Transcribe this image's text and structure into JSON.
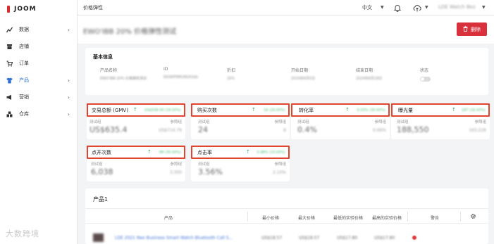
{
  "app": {
    "logo": "JOOM"
  },
  "sidebar": {
    "items": [
      {
        "label": "数据",
        "icon": "analytics-icon"
      },
      {
        "label": "店铺",
        "icon": "store-icon"
      },
      {
        "label": "订单",
        "icon": "cart-icon"
      },
      {
        "label": "产品",
        "icon": "tshirt-icon"
      },
      {
        "label": "营销",
        "icon": "megaphone-icon"
      },
      {
        "label": "仓库",
        "icon": "warehouse-icon"
      }
    ],
    "watermark": "大数跨境"
  },
  "topbar": {
    "title": "价格弹性",
    "language": "中文",
    "user": "LDE Watch Bez"
  },
  "header": {
    "title": "EWO'IBB 20% 价格弹性测试",
    "delete_label": "删除"
  },
  "basic_info": {
    "title": "基本信息",
    "fields": {
      "product_name": {
        "label": "产品名称",
        "value": "EWO'IBB 20% 价格弹性测试"
      },
      "id": {
        "label": "ID",
        "value": "6IGWIPNRUNUlUlab"
      },
      "discount": {
        "label": "折扣",
        "value": "20%"
      },
      "start_date": {
        "label": "开始日期",
        "value": "2024年6月5日"
      },
      "end_date": {
        "label": "结束日期",
        "value": "2024年6月18日"
      },
      "status": {
        "label": "状态"
      }
    }
  },
  "metrics": [
    {
      "name": "交易总额 (GMV)",
      "change": "US$508.00 (19.00%)",
      "test_label": "测试组",
      "ref_label": "参照组",
      "test_value": "US$635.4",
      "ref_value": "US$714.79"
    },
    {
      "name": "购买次数",
      "change": "16 (20.00%)",
      "test_label": "测试组",
      "ref_label": "参照组",
      "test_value": "24",
      "ref_value": "8"
    },
    {
      "name": "转化率",
      "change": "0.03% (30.00%)",
      "test_label": "测试组",
      "ref_label": "参照组",
      "test_value": "0.4%",
      "ref_value": "0.06%"
    },
    {
      "name": "曝光量",
      "change": "187 (16.00%)",
      "test_label": "测试组",
      "ref_label": "参照组",
      "test_value": "188,550",
      "ref_value": "163,226"
    },
    {
      "name": "点开次数",
      "change": "88 (30.00%)",
      "test_label": "测试组",
      "ref_label": "参照组",
      "test_value": "6,038",
      "ref_value": "3,300"
    },
    {
      "name": "点击率",
      "change": "0.98% (10.00%)",
      "test_label": "测试组",
      "ref_label": "参照组",
      "test_value": "3.56%",
      "ref_value": "2.10%"
    }
  ],
  "products": {
    "title": "产品1",
    "columns": [
      "产品",
      "最小价格",
      "最大价格",
      "最低的实验价格",
      "最高的实验价格",
      "警告"
    ],
    "rows": [
      {
        "name": "LDE 2021 Neo Business Smart Watch Bluetooth Call S...",
        "min_price": "US$18.57",
        "max_price": "US$18.57",
        "min_test_price": "US$17.80",
        "max_test_price": "US$17.80"
      }
    ]
  },
  "colors": {
    "accent": "#2d6fd6",
    "danger": "#d9313c",
    "highlight_border": "#e2452d",
    "positive": "#2fae5c"
  }
}
